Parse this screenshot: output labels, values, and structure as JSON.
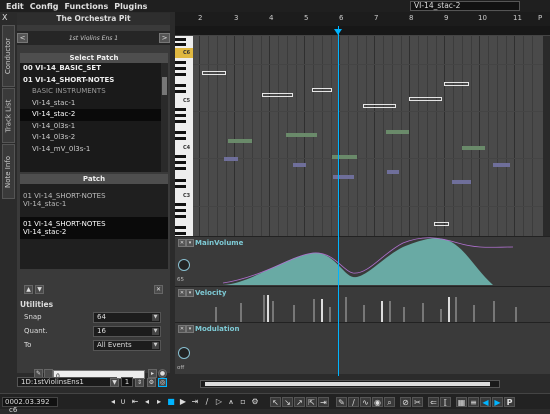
{
  "menu": {
    "items": [
      "Edit",
      "Config",
      "Functions",
      "Plugins"
    ]
  },
  "track_title": "VI-14_stac-2",
  "close_label": "X",
  "side_tabs": {
    "conductor": "Conductor",
    "track_list": "Track List",
    "note_info": "Note Info"
  },
  "left_panel": {
    "title": "The Orchestra Pit",
    "instrument_name": "1st Violins Ens 1",
    "prev_label": "<",
    "next_label": ">",
    "select_patch_header": "Select Patch",
    "patch_list": [
      {
        "label": "00 VI-14_BASIC_SET",
        "kind": "bold"
      },
      {
        "label": "01 VI-14_SHORT-NOTES",
        "kind": "bold"
      },
      {
        "label": "BASIC INSTRUMENTS",
        "kind": "label"
      },
      {
        "label": "VI-14_stac-1",
        "kind": "item"
      },
      {
        "label": "VI-14_stac-2",
        "kind": "sel"
      },
      {
        "label": "VI-14_0l3s-1",
        "kind": "item"
      },
      {
        "label": "VI-14_0l3s-2",
        "kind": "item"
      },
      {
        "label": "VI-14_mV_0l3s-1",
        "kind": "item"
      }
    ],
    "patch_header": "Patch",
    "patch_assignments": [
      {
        "line1": "01 VI-14_SHORT-NOTES",
        "line2": "VI-14_stac-1"
      },
      {
        "line1": "01 VI-14_SHORT-NOTES",
        "line2": "VI-14_stac-2"
      }
    ],
    "utilities": {
      "title": "Utilities",
      "snap": {
        "label": "Snap",
        "value": "64"
      },
      "quant": {
        "label": "Quant.",
        "value": "16"
      },
      "to": {
        "label": "To",
        "value": "All Events"
      },
      "input_value": "0"
    },
    "track_select": "1D:1stViolinsEns1",
    "track_number": "1"
  },
  "ruler": {
    "bars": [
      "2",
      "3",
      "4",
      "5",
      "6",
      "7",
      "8",
      "9",
      "10",
      "11",
      "P"
    ],
    "octave_labels": [
      "C6",
      "C5",
      "C4",
      "C3"
    ]
  },
  "lanes": {
    "main_volume": {
      "title": "MainVolume",
      "knob_value": "65"
    },
    "velocity": {
      "title": "Velocity"
    },
    "modulation": {
      "title": "Modulation",
      "knob_value": "off"
    }
  },
  "status": {
    "time": "0002.03.392",
    "note": "c6"
  },
  "colors": {
    "accent": "#00b4ff",
    "lane_title": "#7ecbd6",
    "curve_fill": "#6fb7b0"
  }
}
